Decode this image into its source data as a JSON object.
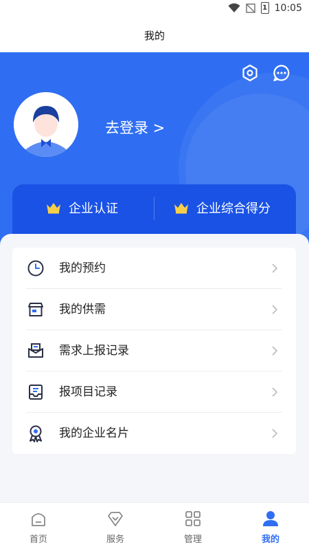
{
  "status": {
    "time": "10:05",
    "battery_level": "1"
  },
  "title": "我的",
  "login_text": "去登录 >",
  "cert": {
    "left": "企业认证",
    "right": "企业综合得分"
  },
  "menu": [
    {
      "label": "我的预约",
      "icon": "clock-icon"
    },
    {
      "label": "我的供需",
      "icon": "store-icon"
    },
    {
      "label": "需求上报记录",
      "icon": "mail-icon"
    },
    {
      "label": "报项目记录",
      "icon": "inbox-icon"
    },
    {
      "label": "我的企业名片",
      "icon": "badge-icon"
    }
  ],
  "tabs": [
    {
      "label": "首页",
      "icon": "home-icon"
    },
    {
      "label": "服务",
      "icon": "diamond-icon"
    },
    {
      "label": "管理",
      "icon": "grid-icon"
    },
    {
      "label": "我的",
      "icon": "person-icon",
      "active": true
    }
  ],
  "colors": {
    "primary": "#2f6ef2",
    "card": "#1a52e6",
    "crown": "#f6cf4a"
  }
}
